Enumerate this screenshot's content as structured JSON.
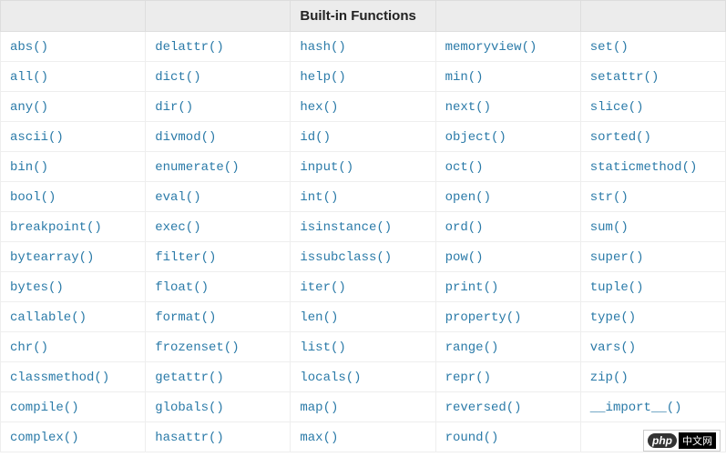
{
  "header": {
    "columns": [
      "",
      "",
      "Built-in Functions",
      "",
      ""
    ]
  },
  "rows": [
    [
      "abs()",
      "delattr()",
      "hash()",
      "memoryview()",
      "set()"
    ],
    [
      "all()",
      "dict()",
      "help()",
      "min()",
      "setattr()"
    ],
    [
      "any()",
      "dir()",
      "hex()",
      "next()",
      "slice()"
    ],
    [
      "ascii()",
      "divmod()",
      "id()",
      "object()",
      "sorted()"
    ],
    [
      "bin()",
      "enumerate()",
      "input()",
      "oct()",
      "staticmethod()"
    ],
    [
      "bool()",
      "eval()",
      "int()",
      "open()",
      "str()"
    ],
    [
      "breakpoint()",
      "exec()",
      "isinstance()",
      "ord()",
      "sum()"
    ],
    [
      "bytearray()",
      "filter()",
      "issubclass()",
      "pow()",
      "super()"
    ],
    [
      "bytes()",
      "float()",
      "iter()",
      "print()",
      "tuple()"
    ],
    [
      "callable()",
      "format()",
      "len()",
      "property()",
      "type()"
    ],
    [
      "chr()",
      "frozenset()",
      "list()",
      "range()",
      "vars()"
    ],
    [
      "classmethod()",
      "getattr()",
      "locals()",
      "repr()",
      "zip()"
    ],
    [
      "compile()",
      "globals()",
      "map()",
      "reversed()",
      "__import__()"
    ],
    [
      "complex()",
      "hasattr()",
      "max()",
      "round()",
      ""
    ]
  ],
  "watermark": {
    "logo": "php",
    "suffix": "中文网"
  }
}
